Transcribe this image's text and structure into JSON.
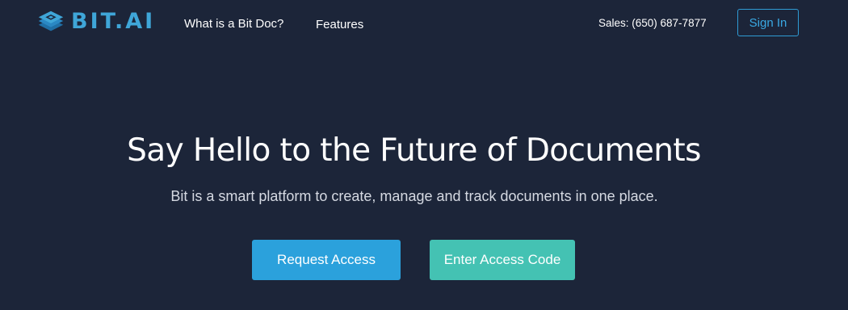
{
  "header": {
    "logo_text": "BIT.AI",
    "nav": {
      "what_is": "What is a Bit Doc?",
      "features": "Features"
    },
    "sales": "Sales: (650) 687-7877",
    "signin_label": "Sign In"
  },
  "hero": {
    "title": "Say Hello to the Future of Documents",
    "subtitle": "Bit is a smart platform to create, manage and track documents in one place."
  },
  "actions": {
    "request_label": "Request Access",
    "code_label": "Enter Access Code"
  },
  "colors": {
    "background": "#1c2539",
    "brand_blue": "#2ba1dc",
    "teal": "#44c2b3",
    "logo_blue": "#3fa6d8"
  },
  "icons": {
    "logo_mark": "stacked-layers-logo-icon"
  }
}
